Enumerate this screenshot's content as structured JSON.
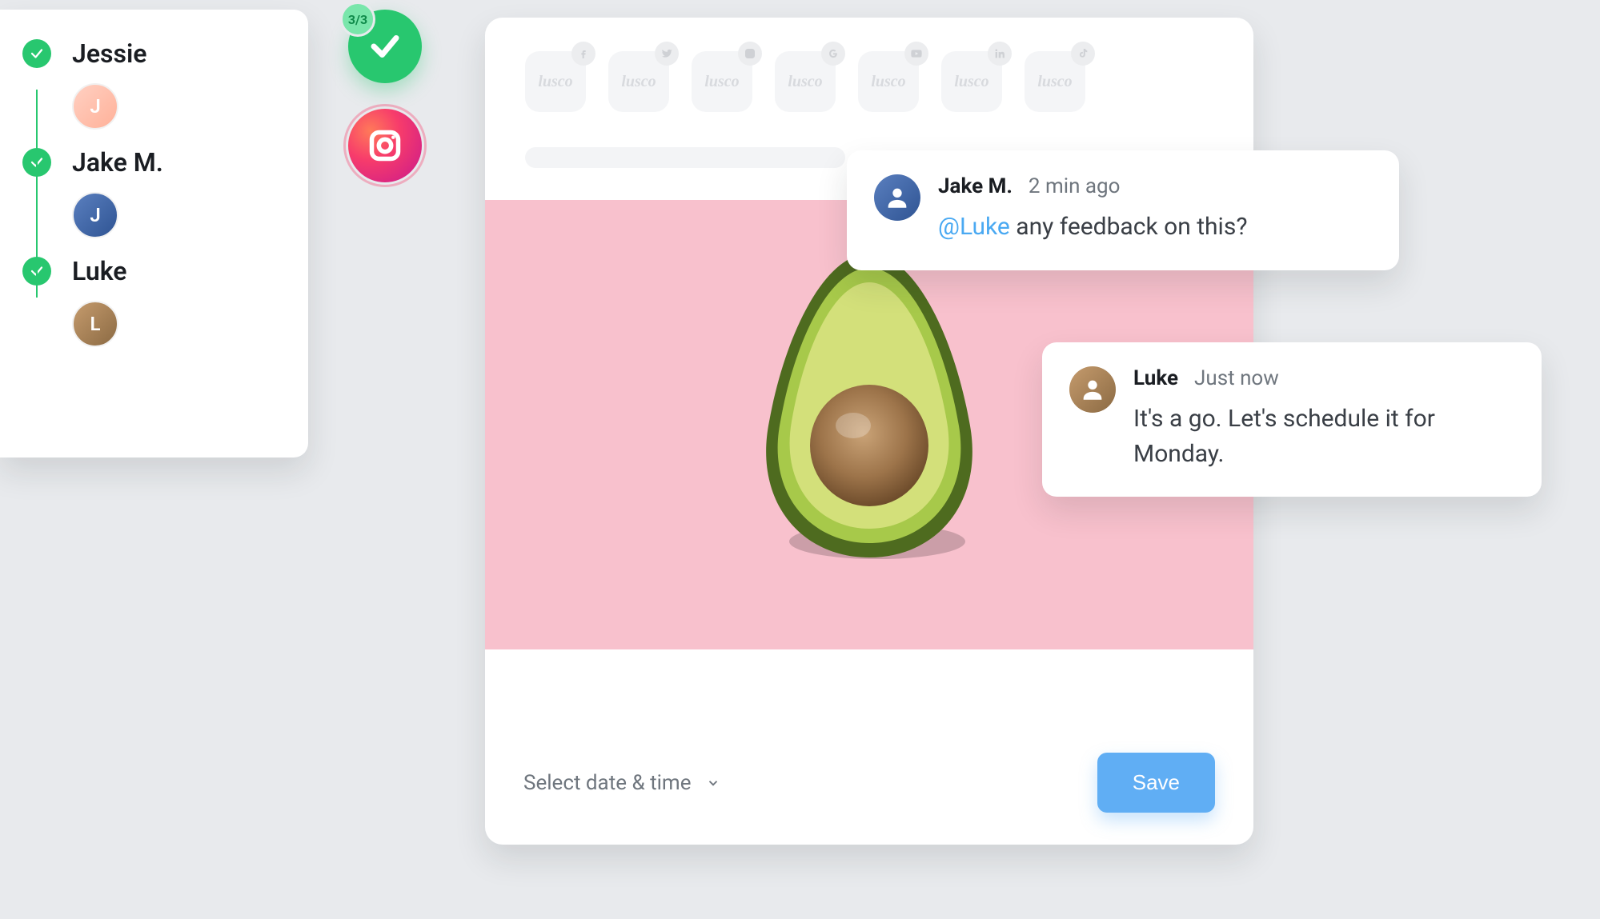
{
  "approvers": {
    "items": [
      {
        "name": "Jessie",
        "initial": "J",
        "avatar_css": "av-jessie"
      },
      {
        "name": "Jake M.",
        "initial": "J",
        "avatar_css": "av-jake"
      },
      {
        "name": "Luke",
        "initial": "L",
        "avatar_css": "av-luke"
      }
    ]
  },
  "status": {
    "badge": "3/3"
  },
  "composer": {
    "brand": "lusco",
    "channels": [
      {
        "id": "facebook",
        "icon": "facebook-icon"
      },
      {
        "id": "twitter",
        "icon": "twitter-icon"
      },
      {
        "id": "instagram",
        "icon": "instagram-icon"
      },
      {
        "id": "google",
        "icon": "google-icon"
      },
      {
        "id": "youtube",
        "icon": "youtube-icon"
      },
      {
        "id": "linkedin",
        "icon": "linkedin-icon"
      },
      {
        "id": "tiktok",
        "icon": "tiktok-icon"
      }
    ],
    "date_label": "Select date & time",
    "save_label": "Save",
    "image_subject": "avocado"
  },
  "comments": [
    {
      "author": "Jake M.",
      "time": "2 min ago",
      "mention": "@Luke",
      "body_after": " any feedback on this?",
      "avatar_css": "av-jake"
    },
    {
      "author": "Luke",
      "time": "Just now",
      "mention": "",
      "body_after": "It's a go. Let's schedule it for Monday.",
      "avatar_css": "av-luke"
    }
  ],
  "icons": {
    "check": "check-icon",
    "instagram": "instagram-icon",
    "chevron_down": "chevron-down-icon"
  },
  "colors": {
    "accent_green": "#28c76f",
    "accent_blue": "#60aef4",
    "image_bg": "#f8c1cd"
  }
}
